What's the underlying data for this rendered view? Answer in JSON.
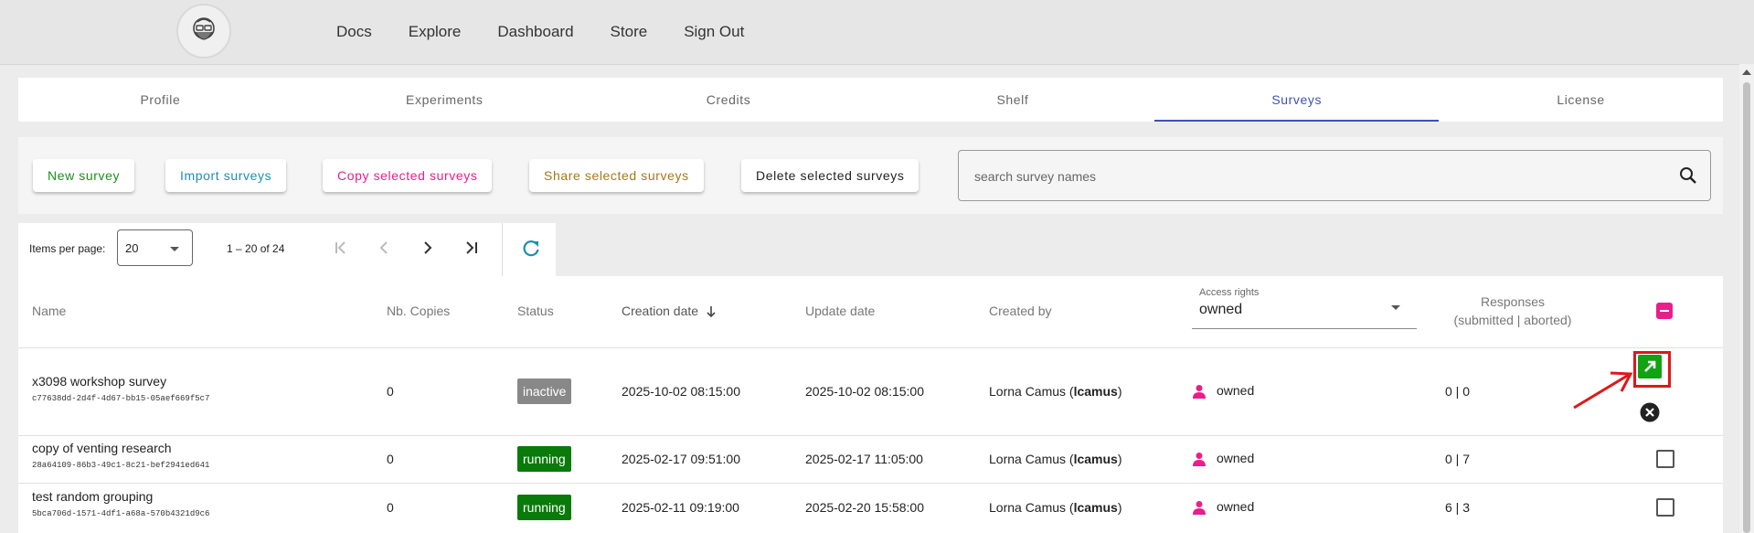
{
  "nav": {
    "links": [
      "Docs",
      "Explore",
      "Dashboard",
      "Store",
      "Sign Out"
    ]
  },
  "tabs": [
    {
      "label": "Profile"
    },
    {
      "label": "Experiments"
    },
    {
      "label": "Credits"
    },
    {
      "label": "Shelf"
    },
    {
      "label": "Surveys",
      "active": true
    },
    {
      "label": "License"
    }
  ],
  "toolbar": {
    "new_survey": "New survey",
    "import_surveys": "Import surveys",
    "copy_selected": "Copy selected surveys",
    "share_selected": "Share selected surveys",
    "delete_selected": "Delete selected surveys",
    "search_placeholder": "search survey names"
  },
  "paginator": {
    "items_per_page_label": "Items per page:",
    "items_per_page": "20",
    "range": "1 – 20 of 24"
  },
  "table": {
    "headers": {
      "name": "Name",
      "copies": "Nb. Copies",
      "status": "Status",
      "creation": "Creation date",
      "update": "Update date",
      "created_by": "Created by",
      "access_label": "Access rights",
      "access_value": "owned",
      "responses_line1": "Responses",
      "responses_line2": "(submitted | aborted)"
    },
    "rows": [
      {
        "name": "x3098 workshop survey",
        "id": "c77638dd-2d4f-4d67-bb15-05aef669f5c7",
        "copies": "0",
        "status": "inactive",
        "created": "2025-10-02 08:15:00",
        "updated": "2025-10-02 08:15:00",
        "creator_name": "Lorna Camus (",
        "creator_handle": "lcamus",
        "creator_close": ")",
        "access": "owned",
        "responses": "0 | 0"
      },
      {
        "name": "copy of venting research",
        "id": "28a64109-86b3-49c1-8c21-bef2941ed641",
        "copies": "0",
        "status": "running",
        "created": "2025-02-17 09:51:00",
        "updated": "2025-02-17 11:05:00",
        "creator_name": "Lorna Camus (",
        "creator_handle": "lcamus",
        "creator_close": ")",
        "access": "owned",
        "responses": "0 | 7"
      },
      {
        "name": "test random grouping",
        "id": "5bca706d-1571-4df1-a68a-570b4321d9c6",
        "copies": "0",
        "status": "running",
        "created": "2025-02-11 09:19:00",
        "updated": "2025-02-20 15:58:00",
        "creator_name": "Lorna Camus (",
        "creator_handle": "lcamus",
        "creator_close": ")",
        "access": "owned",
        "responses": "6 | 3"
      }
    ]
  },
  "colors": {
    "accent": "#3f51b5",
    "running": "#0a7a0a",
    "inactive": "#888888",
    "pink": "#e91e8c",
    "highlight": "#e0161a",
    "open_button": "#12a312"
  }
}
